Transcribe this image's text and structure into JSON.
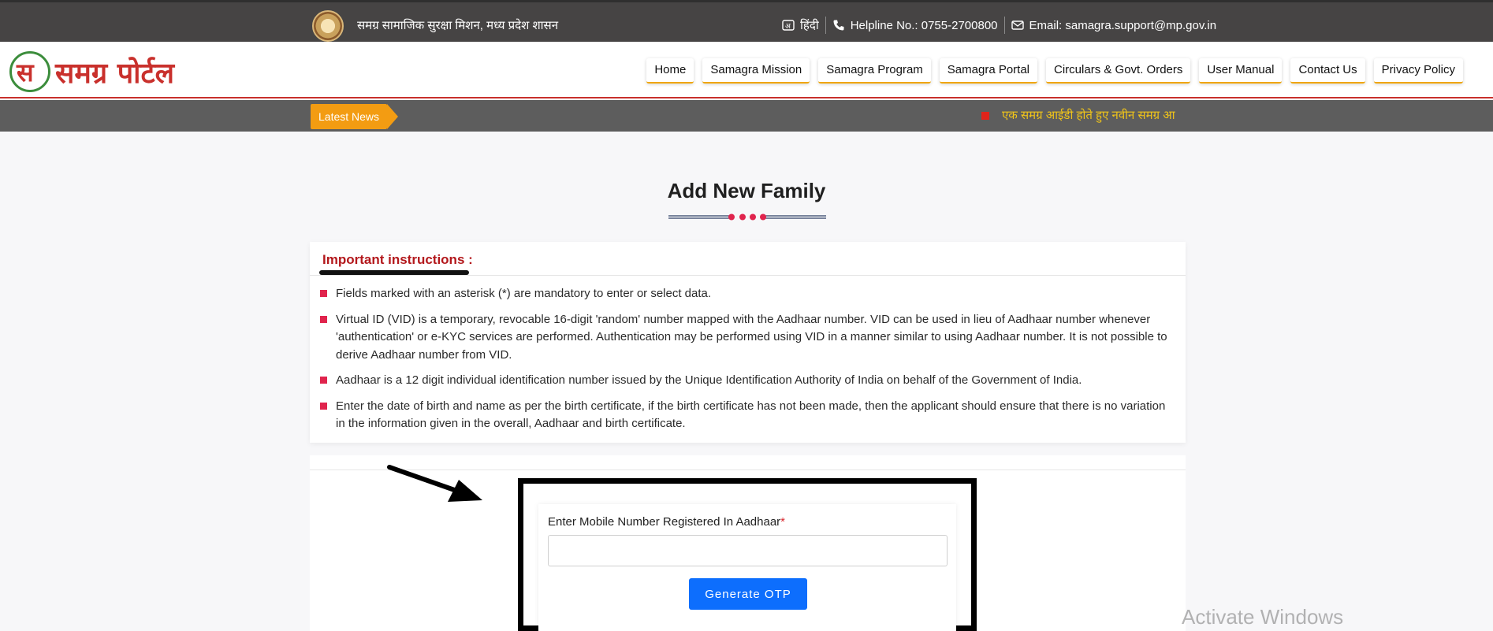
{
  "topbar": {
    "org_name": "समग्र सामाजिक सुरक्षा मिशन, मध्य प्रदेश शासन",
    "language": "हिंदी",
    "helpline": "Helpline No.: 0755-2700800",
    "email": "Email: samagra.support@mp.gov.in"
  },
  "header": {
    "logo_text": "समग्र पोर्टल",
    "logo_glyph": "स",
    "nav": [
      "Home",
      "Samagra Mission",
      "Samagra Program",
      "Samagra Portal",
      "Circulars & Govt. Orders",
      "User Manual",
      "Contact Us",
      "Privacy Policy"
    ]
  },
  "news": {
    "label": "Latest News",
    "ticker": "एक समग्र आईडी होते हुए नवीन समग्र आ"
  },
  "page": {
    "title": "Add New Family"
  },
  "instructions": {
    "heading": "Important instructions :",
    "items": [
      "Fields marked with an asterisk (*) are mandatory to enter or select data.",
      "Virtual ID (VID) is a temporary, revocable 16-digit 'random' number mapped with the Aadhaar number. VID can be used in lieu of Aadhaar number whenever 'authentication' or e-KYC services are performed. Authentication may be performed using VID in a manner similar to using Aadhaar number. It is not possible to derive Aadhaar number from VID.",
      "Aadhaar is a 12 digit individual identification number issued by the Unique Identification Authority of India on behalf of the Government of India.",
      "Enter the date of birth and name as per the birth certificate, if the birth certificate has not been made, then the applicant should ensure that there is no variation in the information given in the overall, Aadhaar and birth certificate."
    ]
  },
  "form": {
    "mobile_label": "Enter Mobile Number Registered In Aadhaar",
    "required_mark": "*",
    "mobile_value": "",
    "mobile_placeholder": "",
    "generate_otp": "Generate OTP"
  },
  "overlay": {
    "watermark": "Activate Windows"
  },
  "colors": {
    "topbar_bg": "#464444",
    "accent_red": "#c9302c",
    "news_label": "#f39c12",
    "button_blue": "#0d6efd",
    "bullet": "#e0244d"
  }
}
